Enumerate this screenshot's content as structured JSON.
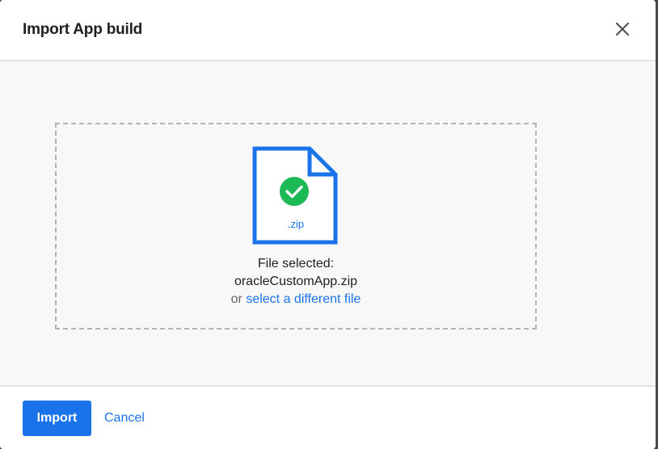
{
  "dialog": {
    "title": "Import App build",
    "close_icon": "close-icon"
  },
  "dropzone": {
    "file_extension": ".zip",
    "status_label": "File selected:",
    "file_name": "oracleCustomApp.zip",
    "or_text": "or",
    "select_link": "select a different file",
    "file_icon": "file-icon",
    "check_icon": "check-circle-icon"
  },
  "footer": {
    "import_label": "Import",
    "cancel_label": "Cancel"
  },
  "colors": {
    "accent": "#1a73e8",
    "success": "#1db954",
    "body_bg": "#f8f8f8"
  }
}
